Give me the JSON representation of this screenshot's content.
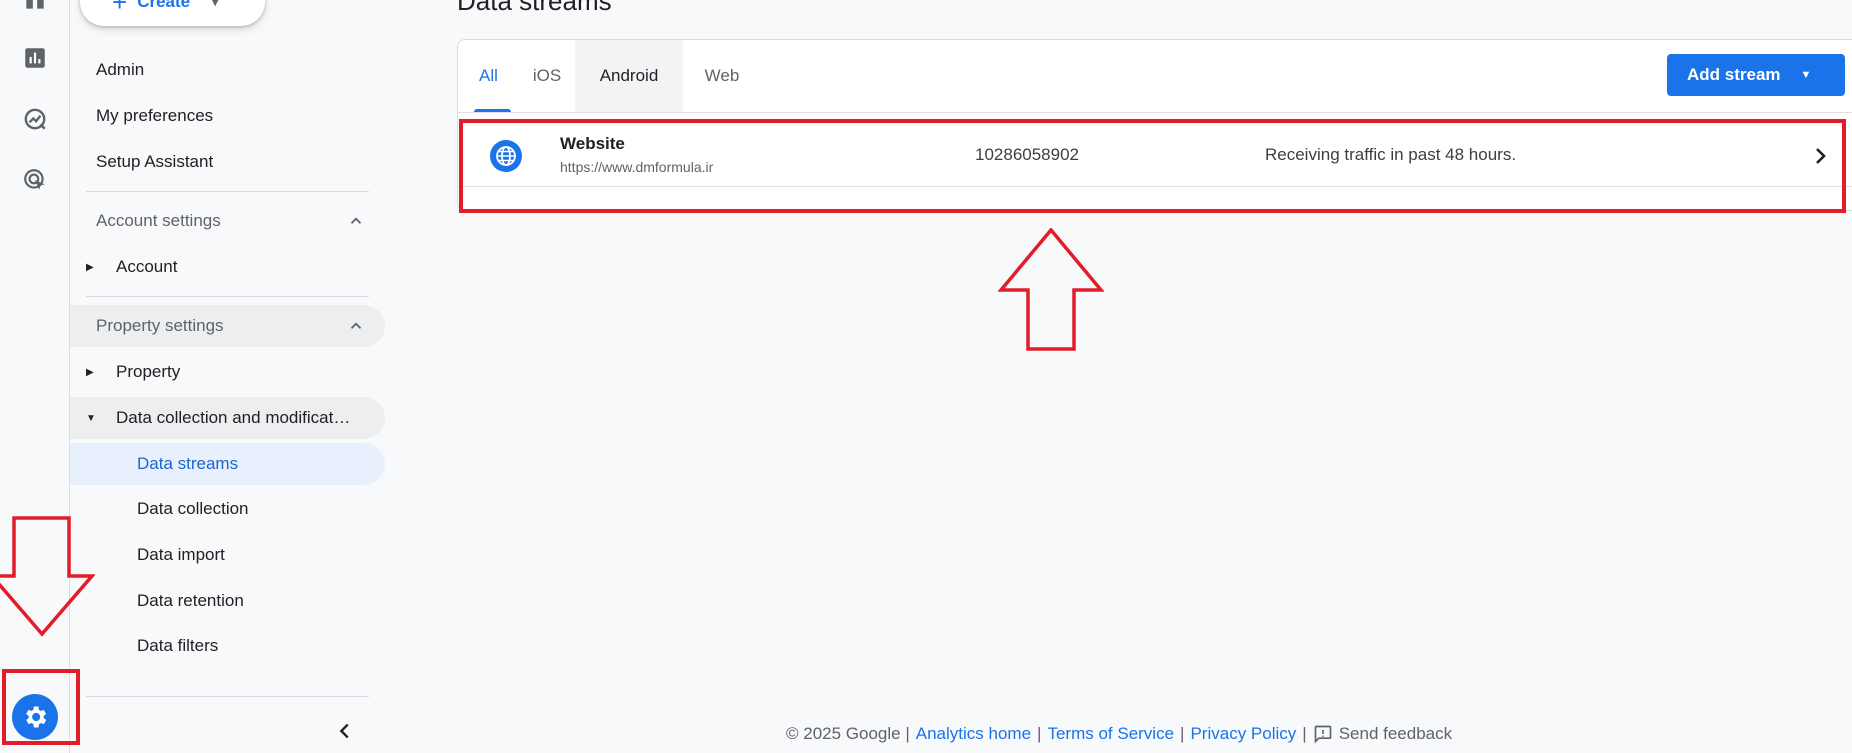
{
  "sidebar": {
    "create_label": "Create",
    "top_items": [
      "Admin",
      "My preferences",
      "Setup Assistant"
    ],
    "account_settings": {
      "header": "Account settings",
      "items": [
        "Account"
      ]
    },
    "property_settings": {
      "header": "Property settings",
      "property": "Property",
      "data_collection": "Data collection and modificat…",
      "sub_items": [
        "Data streams",
        "Data collection",
        "Data import",
        "Data retention",
        "Data filters"
      ]
    }
  },
  "main": {
    "page_title": "Data streams",
    "tabs": [
      "All",
      "iOS",
      "Android",
      "Web"
    ],
    "add_stream_label": "Add stream",
    "stream": {
      "name": "Website",
      "url": "https://www.dmformula.ir",
      "id": "10286058902",
      "status": "Receiving traffic in past 48 hours."
    }
  },
  "footer": {
    "copyright": "© 2025 Google |",
    "links": [
      "Analytics home",
      "Terms of Service",
      "Privacy Policy"
    ],
    "send_feedback": "Send feedback"
  },
  "colors": {
    "accent": "#1a73e8",
    "annotation_red": "#e11d2a"
  }
}
